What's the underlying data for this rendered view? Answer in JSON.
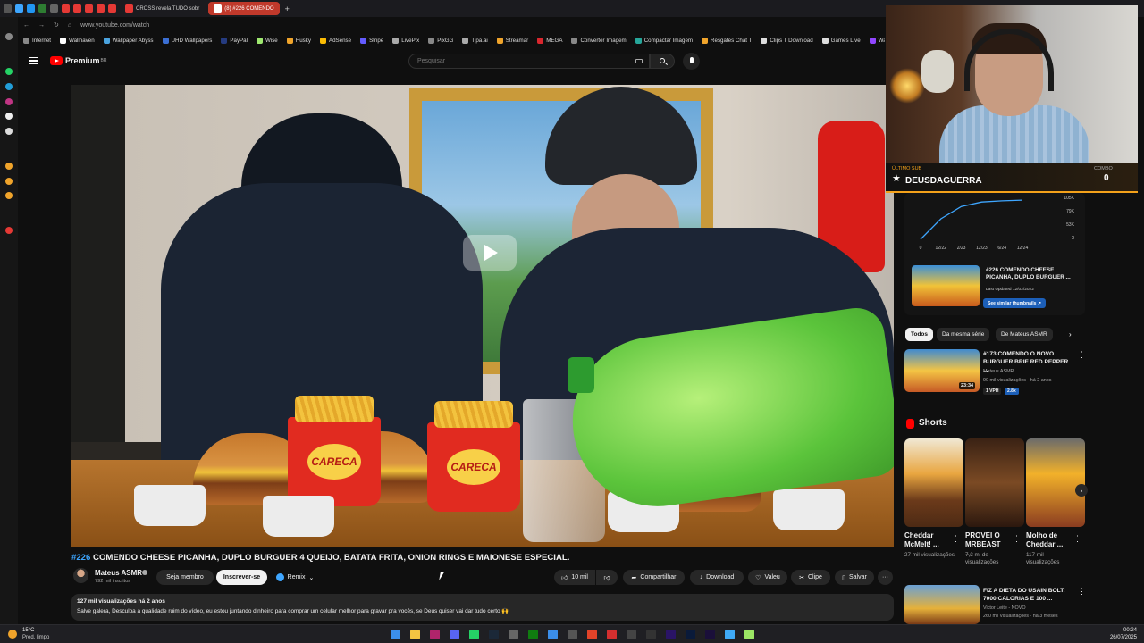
{
  "browser": {
    "tabs": [
      {
        "label": "CROSS revela TUDO sobr",
        "active": false
      },
      {
        "label": "(8) #226 COMENDO",
        "active": true
      }
    ],
    "url": "www.youtube.com/watch",
    "bookmarks": [
      "Internet",
      "Wallhaven",
      "Wallpaper Abyss",
      "UHD Wallpapers",
      "PayPal",
      "Wise",
      "Husky",
      "AdSense",
      "Stripe",
      "LivePix",
      "PixGG",
      "Tipa.ai",
      "Streamar",
      "MEGA",
      "Converter Imagem",
      "Compactar Imagem",
      "Resgates Chat T",
      "Clips T Download",
      "Games Live",
      "Wa"
    ]
  },
  "header": {
    "logo": "Premium",
    "logo_region": "BR",
    "search_placeholder": "Pesquisar"
  },
  "video": {
    "tag": "#226",
    "title": "COMENDO CHEESE PICANHA, DUPLO BURGUER 4 QUEIJO, BATATA FRITA, ONION RINGS E MAIONESE ESPECIAL.",
    "fries_brand": "CARECA",
    "channel": "Mateus ASMR",
    "subscribers": "792 mil inscritos",
    "join_label": "Seja membro",
    "subscribe_label": "Inscrever-se",
    "remix_label": "Remix",
    "likes": "10 mil",
    "share_label": "Compartilhar",
    "download_label": "Download",
    "thanks_label": "Valeu",
    "clip_label": "Clipe",
    "save_label": "Salvar",
    "more_label": "···",
    "stats": "127 mil visualizações  há 2 anos",
    "description": "Salve galera, Desculpa a qualidade ruim do vídeo, eu estou juntando dinheiro para comprar um celular melhor para gravar pra vocês, se Deus quiser vai dar tudo certo 🙌"
  },
  "webcam": {
    "last_sub_label": "ÚLTIMO SUB",
    "last_sub_name": "DEUSDAGUERRA",
    "combo_label": "COMBO",
    "combo_value": "0"
  },
  "stats_card": {
    "title": "#226 COMENDO CHEESE PICANHA, DUPLO BURGUER ...",
    "updated": "Last Updated 12/02/2022",
    "similar_label": "See similar thumbnails ↗"
  },
  "chart_data": {
    "type": "line",
    "x": [
      "0",
      "12/22",
      "2/23",
      "12/23",
      "6/24",
      "12/24"
    ],
    "ytick_labels": [
      "105K",
      "79K",
      "53K",
      "0"
    ],
    "values": [
      0,
      55000,
      88000,
      100000,
      103000,
      105000
    ],
    "ylim": [
      0,
      110000
    ],
    "color": "#3ea6ff"
  },
  "chips": {
    "all": "Todos",
    "series": "Da mesma série",
    "channel": "De Mateus ASMR"
  },
  "recommendation": {
    "title": "#173 COMENDO O NOVO BURGUER BRIE RED PEPPER ...",
    "channel": "Mateus ASMR",
    "meta": "90 mil visualizações · há 2 anos",
    "duration": "23:34",
    "vph": "1 VPH",
    "badge": "2.8x"
  },
  "shorts": {
    "heading": "Shorts",
    "items": [
      {
        "title": "Cheddar McMelt! ...",
        "views": "27 mil visualizações"
      },
      {
        "title": "PROVEI O MRBEAST ...",
        "views": "7,2 mi de visualizações"
      },
      {
        "title": "Molho de Cheddar ...",
        "views": "117 mil visualizações"
      }
    ]
  },
  "recommendation2": {
    "title": "FIZ A DIETA DO USAIN BOLT: 7000 CALORIAS E 100 ...",
    "channel": "Victor Leite - NOVO",
    "meta": "260 mil visualizações · há 3 meses"
  },
  "taskbar": {
    "temp": "15°C",
    "weather": "Pred. limpo",
    "time": "00:24",
    "date": "26/07/2025"
  },
  "colors": {
    "accent": "#3ea6ff",
    "brand": "#ff0000",
    "subscribe_bg": "#f1f1f1",
    "overlay_accent": "#f3a11a"
  }
}
